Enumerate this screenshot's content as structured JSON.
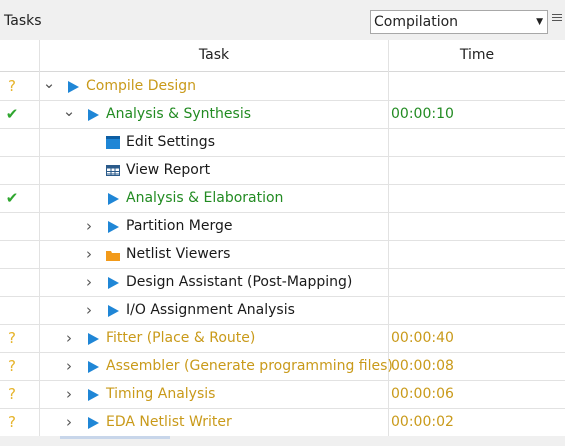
{
  "panel": {
    "title": "Tasks",
    "flow_select": {
      "value": "Compilation"
    }
  },
  "columns": {
    "task": "Task",
    "time": "Time"
  },
  "colors": {
    "pending": "#e6b42c",
    "done": "#2fa62f",
    "running_text": "#c99a1a",
    "success_text": "#228b22",
    "play_icon": "#1f86d6",
    "folder_icon": "#f29a1a"
  },
  "tasks": [
    {
      "status": "pending",
      "status_icon": "question-icon",
      "expander": "expanded",
      "icon": "play-icon",
      "label": "Compile Design",
      "time": "",
      "tone": "orange"
    },
    {
      "status": "done",
      "status_icon": "checkmark-icon",
      "expander": "expanded",
      "icon": "play-icon",
      "label": "Analysis & Synthesis",
      "time": "00:00:10",
      "tone": "green"
    },
    {
      "status": "",
      "status_icon": "",
      "expander": "",
      "icon": "settings-window-icon",
      "label": "Edit Settings",
      "time": "",
      "tone": "dark"
    },
    {
      "status": "",
      "status_icon": "",
      "expander": "",
      "icon": "report-table-icon",
      "label": "View Report",
      "time": "",
      "tone": "dark"
    },
    {
      "status": "done",
      "status_icon": "checkmark-icon",
      "expander": "",
      "icon": "play-icon",
      "label": "Analysis & Elaboration",
      "time": "",
      "tone": "green"
    },
    {
      "status": "",
      "status_icon": "",
      "expander": "collapsed",
      "icon": "play-icon",
      "label": "Partition Merge",
      "time": "",
      "tone": "dark"
    },
    {
      "status": "",
      "status_icon": "",
      "expander": "collapsed",
      "icon": "folder-icon",
      "label": "Netlist Viewers",
      "time": "",
      "tone": "dark"
    },
    {
      "status": "",
      "status_icon": "",
      "expander": "collapsed",
      "icon": "play-icon",
      "label": "Design Assistant (Post-Mapping)",
      "time": "",
      "tone": "dark"
    },
    {
      "status": "",
      "status_icon": "",
      "expander": "collapsed",
      "icon": "play-icon",
      "label": "I/O Assignment Analysis",
      "time": "",
      "tone": "dark"
    },
    {
      "status": "pending",
      "status_icon": "question-icon",
      "expander": "collapsed",
      "icon": "play-icon",
      "label": "Fitter (Place & Route)",
      "time": "00:00:40",
      "tone": "orange"
    },
    {
      "status": "pending",
      "status_icon": "question-icon",
      "expander": "collapsed",
      "icon": "play-icon",
      "label": "Assembler (Generate programming files)",
      "time": "00:00:08",
      "tone": "orange"
    },
    {
      "status": "pending",
      "status_icon": "question-icon",
      "expander": "collapsed",
      "icon": "play-icon",
      "label": "Timing Analysis",
      "time": "00:00:06",
      "tone": "orange"
    },
    {
      "status": "pending",
      "status_icon": "question-icon",
      "expander": "collapsed",
      "icon": "play-icon",
      "label": "EDA Netlist Writer",
      "time": "00:00:02",
      "tone": "orange"
    }
  ]
}
